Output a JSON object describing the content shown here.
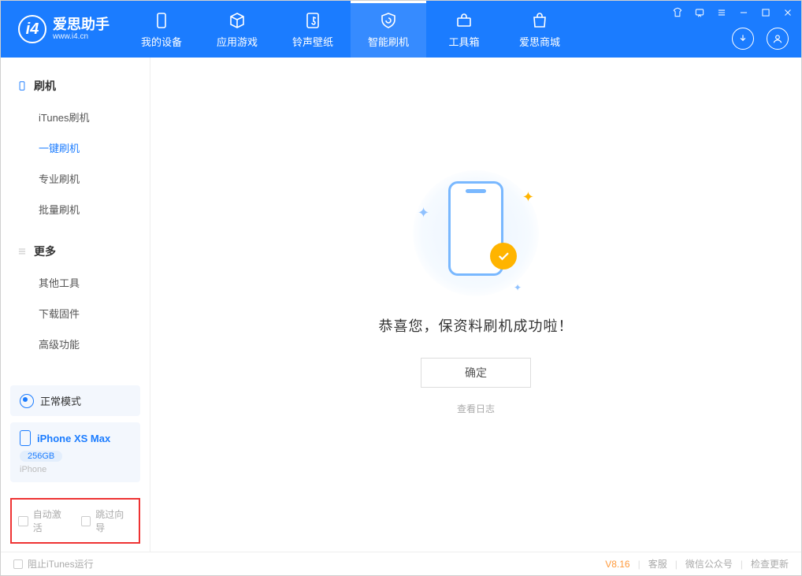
{
  "app": {
    "name_cn": "爱思助手",
    "name_en": "www.i4.cn",
    "logo_letter": "i4"
  },
  "nav": {
    "items": [
      {
        "label": "我的设备"
      },
      {
        "label": "应用游戏"
      },
      {
        "label": "铃声壁纸"
      },
      {
        "label": "智能刷机"
      },
      {
        "label": "工具箱"
      },
      {
        "label": "爱思商城"
      }
    ]
  },
  "sidebar": {
    "group1": "刷机",
    "items1": [
      "iTunes刷机",
      "一键刷机",
      "专业刷机",
      "批量刷机"
    ],
    "group2": "更多",
    "items2": [
      "其他工具",
      "下载固件",
      "高级功能"
    ],
    "mode": "正常模式",
    "device": {
      "name": "iPhone XS Max",
      "storage": "256GB",
      "type": "iPhone"
    },
    "chk1": "自动激活",
    "chk2": "跳过向导"
  },
  "main": {
    "message": "恭喜您，保资料刷机成功啦！",
    "ok": "确定",
    "log": "查看日志"
  },
  "footer": {
    "block_itunes": "阻止iTunes运行",
    "version": "V8.16",
    "links": [
      "客服",
      "微信公众号",
      "检查更新"
    ]
  }
}
